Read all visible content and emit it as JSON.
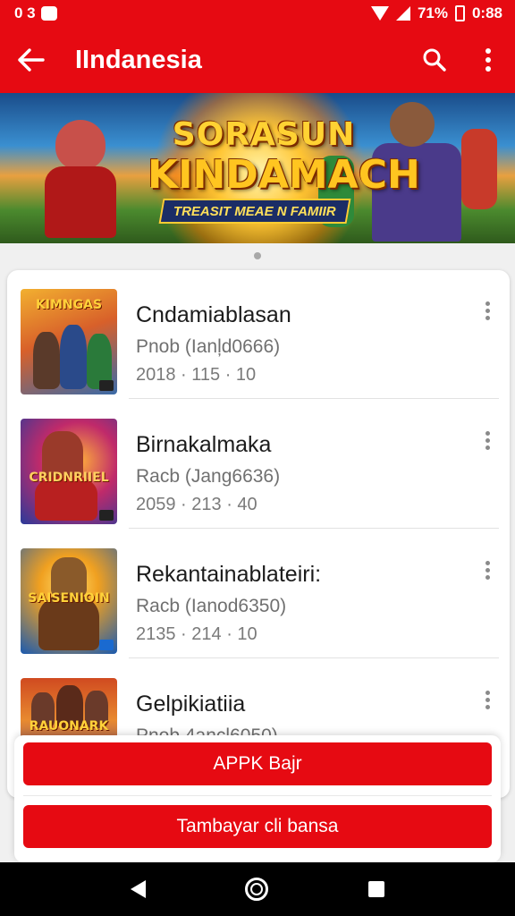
{
  "status_bar": {
    "left_text": "0 3",
    "battery_text": "71%",
    "time": "0:88"
  },
  "app_bar": {
    "title": "IIndanesia",
    "back_icon": "arrow-left-icon",
    "search_icon": "search-icon",
    "more_icon": "more-vert-icon"
  },
  "banner": {
    "title_line1": "SORASUN",
    "title_line2": "KINDAMACH",
    "ribbon_text": "TREASIT MEAE N FAMIIR"
  },
  "apps": [
    {
      "name": "Cndamiablasan",
      "sub": "Pnob (Ianļd0666)",
      "date": "2018 · 115 · 10",
      "thumb_label": "KIMNGAS",
      "thumb_colors": [
        "#e89a2a",
        "#3a6aa8"
      ]
    },
    {
      "name": "Birnakalmaka",
      "sub": "Racb (Jang6636)",
      "date": "2059 · 213 · 40",
      "thumb_label": "CRIDNRIIEL",
      "thumb_colors": [
        "#c02a6a",
        "#2a3a9a"
      ]
    },
    {
      "name": "Rekantainablateiri:",
      "sub": "Racb (Ianod6350)",
      "date": "2135 · 214 · 10",
      "thumb_label": "SAISENIOIN",
      "thumb_colors": [
        "#f0a020",
        "#1a5ab0"
      ]
    },
    {
      "name": "Gelpikiatiia",
      "sub": "Pnob 4ancl6050)",
      "date": "",
      "thumb_label": "RAUONARK",
      "thumb_colors": [
        "#d04a20",
        "#4a2a8a"
      ]
    }
  ],
  "buttons": {
    "primary": "APPK Bajr",
    "secondary": "Tambayar cli bansa"
  },
  "nav_bar": {
    "back_icon": "nav-back-icon",
    "home_icon": "nav-home-icon",
    "recent_icon": "nav-recent-icon"
  }
}
